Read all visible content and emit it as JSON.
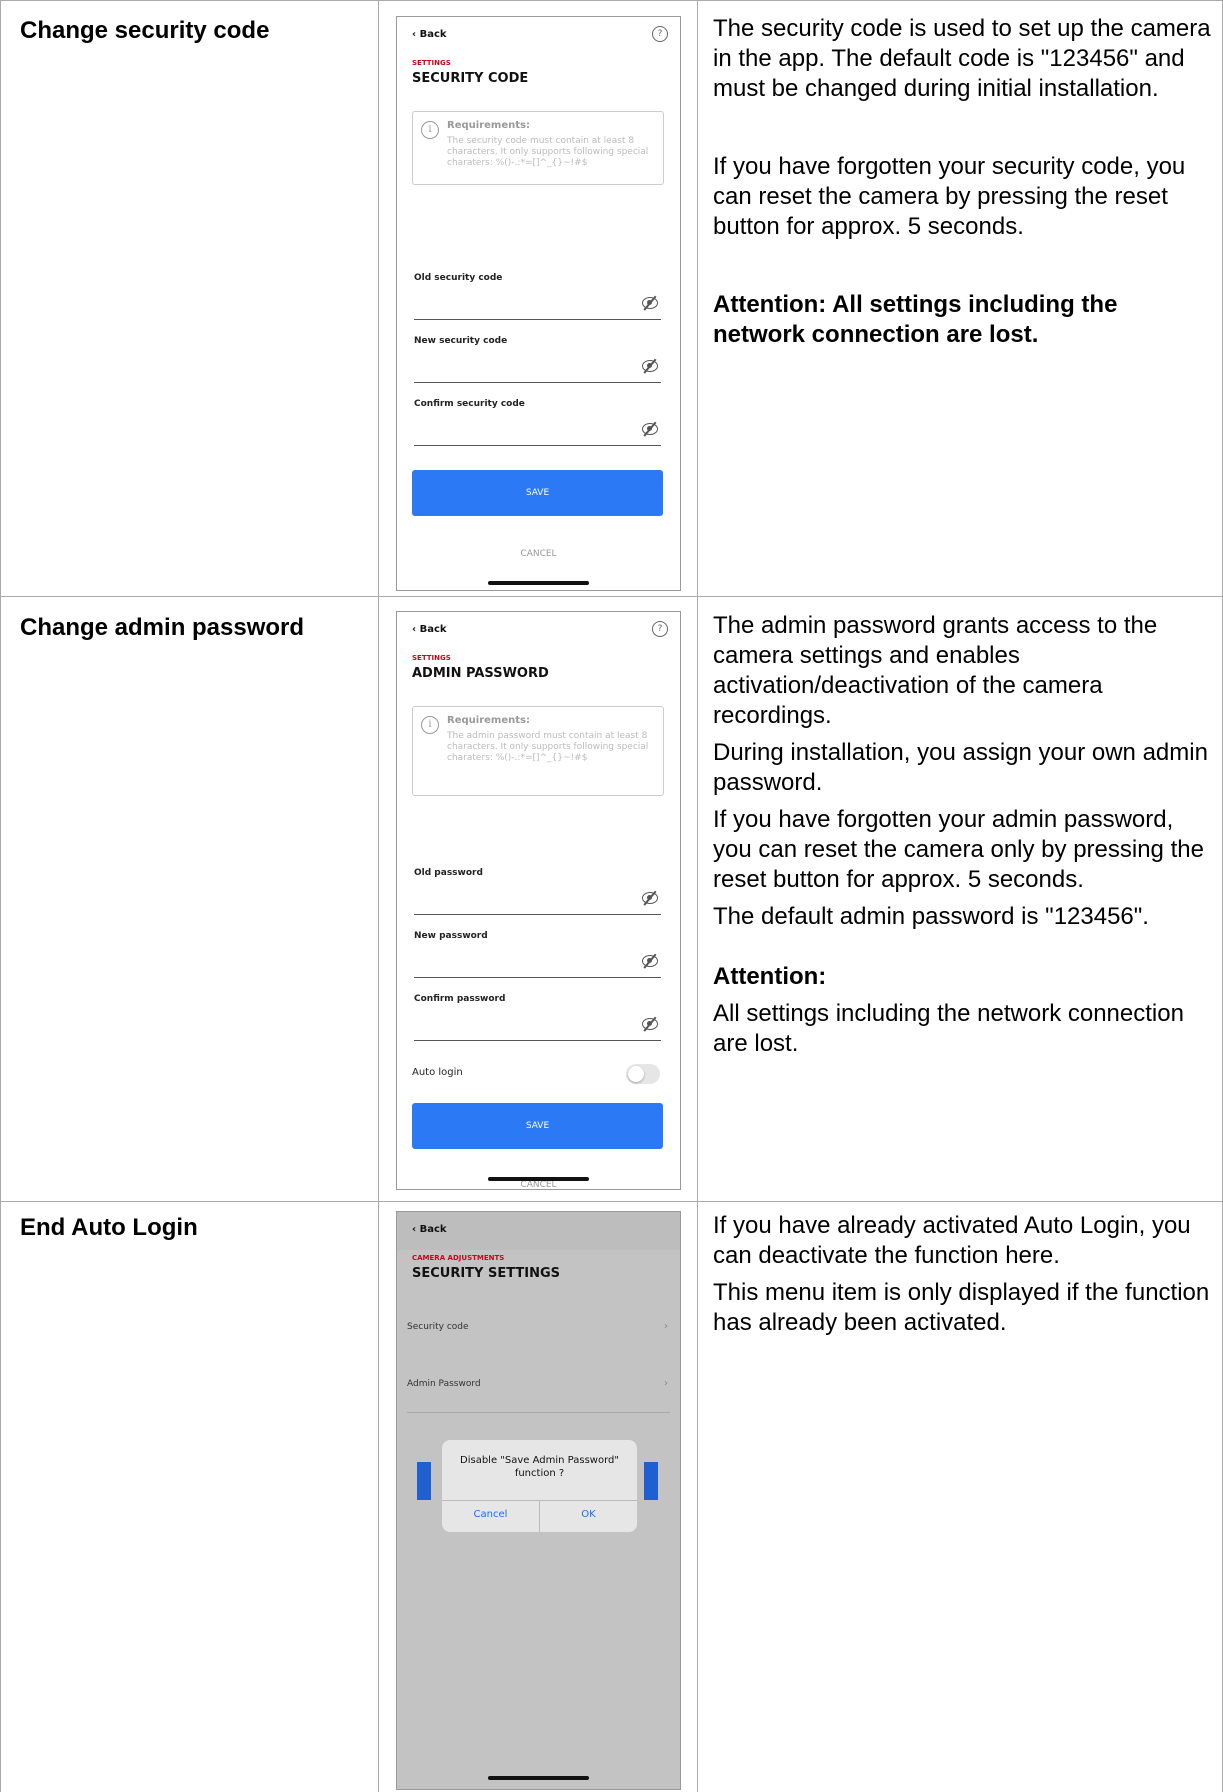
{
  "rows": [
    {
      "title": "Change security code",
      "paragraphs": [
        "The security code is used to set up the camera in the app. The default code is \"123456\" and must be changed during initial installation.",
        "If you have forgotten your security code, you can reset the camera by pressing the reset button for approx. 5 seconds.",
        "Attention:  All settings including the network connection are lost."
      ],
      "screen": {
        "back": "Back",
        "help": "?",
        "crumb": "SETTINGS",
        "title": "SECURITY CODE",
        "req_title": "Requirements:",
        "req_body": "The security code must contain at least 8 characters. It only supports following special charaters: %()-.:*=[]^_{}~!#$",
        "fields": [
          "Old security code",
          "New security code",
          "Confirm security code"
        ],
        "save": "SAVE",
        "cancel": "CANCEL"
      }
    },
    {
      "title": "Change admin password",
      "paragraphs": [
        "The admin password grants access to the camera settings and enables activation/deactivation of the camera recordings.",
        "During installation, you assign your own admin password.",
        "If you have forgotten your admin password, you can reset the camera only by pressing the reset button for approx. 5 seconds.",
        "The default admin password is \"123456\".",
        "Attention:",
        "All settings including the network connection are lost."
      ],
      "screen": {
        "back": "Back",
        "help": "?",
        "crumb": "SETTINGS",
        "title": "ADMIN PASSWORD",
        "req_title": "Requirements:",
        "req_body": "The admin password must contain at least 8 characters. It only supports following special charaters: %()-.:*=[]^_{}~!#$",
        "fields": [
          "Old password",
          "New password",
          "Confirm password"
        ],
        "auto_login": "Auto login",
        "auto_login_on": false,
        "save": "SAVE",
        "cancel": "CANCEL"
      }
    },
    {
      "title": "End Auto Login",
      "paragraphs": [
        "If you have already activated Auto Login, you can deactivate the function here.",
        "This menu item is only displayed if the function has already been activated."
      ],
      "screen": {
        "back": "Back",
        "crumb": "CAMERA ADJUSTMENTS",
        "title": "SECURITY SETTINGS",
        "items": [
          "Security code",
          "Admin Password"
        ],
        "dialog_message": "Disable \"Save Admin Password\" function ?",
        "dialog_cancel": "Cancel",
        "dialog_ok": "OK"
      }
    }
  ]
}
